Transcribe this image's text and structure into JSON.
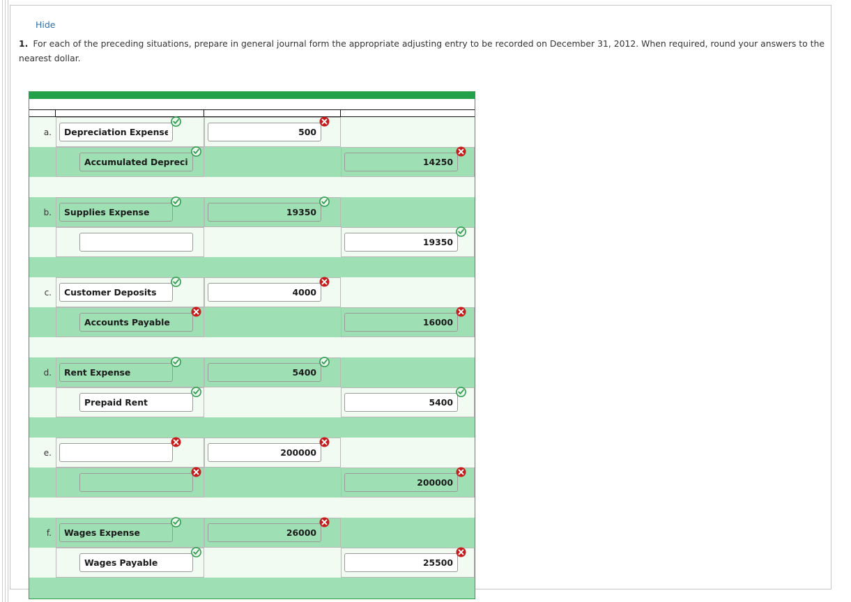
{
  "panel": {
    "hide_label": "Hide",
    "question_number": "1.",
    "question_text": "For each of the preceding situations, prepare in general journal form the appropriate adjusting entry to be recorded on December 31, 2012. When required, round your answers to the nearest dollar."
  },
  "colors": {
    "accent_green": "#22a14a",
    "row_green": "#9fdfb4",
    "row_light": "#f1fbf2",
    "correct": "#2f9e4f",
    "incorrect": "#c81c1c",
    "link": "#2f6fad"
  },
  "journal": {
    "entries": [
      {
        "label": "a.",
        "debit": {
          "account": "Depreciation Expense-Co",
          "account_status": "correct",
          "amount": "500",
          "amount_status": "incorrect"
        },
        "credit": {
          "account": "Accumulated Depreciatio",
          "account_status": "correct",
          "amount": "14250",
          "amount_status": "incorrect"
        }
      },
      {
        "label": "b.",
        "debit": {
          "account": "Supplies Expense",
          "account_status": "correct",
          "amount": "19350",
          "amount_status": "correct"
        },
        "credit": {
          "account": "",
          "account_status": "none",
          "amount": "19350",
          "amount_status": "correct"
        }
      },
      {
        "label": "c.",
        "debit": {
          "account": "Customer Deposits",
          "account_status": "correct",
          "amount": "4000",
          "amount_status": "incorrect"
        },
        "credit": {
          "account": "Accounts Payable",
          "account_status": "incorrect",
          "amount": "16000",
          "amount_status": "incorrect"
        }
      },
      {
        "label": "d.",
        "debit": {
          "account": "Rent Expense",
          "account_status": "correct",
          "amount": "5400",
          "amount_status": "correct"
        },
        "credit": {
          "account": "Prepaid Rent",
          "account_status": "correct",
          "amount": "5400",
          "amount_status": "correct"
        }
      },
      {
        "label": "e.",
        "debit": {
          "account": "",
          "account_status": "incorrect",
          "amount": "200000",
          "amount_status": "incorrect"
        },
        "credit": {
          "account": "",
          "account_status": "incorrect",
          "amount": "200000",
          "amount_status": "incorrect"
        }
      },
      {
        "label": "f.",
        "debit": {
          "account": "Wages Expense",
          "account_status": "correct",
          "amount": "26000",
          "amount_status": "incorrect"
        },
        "credit": {
          "account": "Wages Payable",
          "account_status": "correct",
          "amount": "25500",
          "amount_status": "incorrect"
        }
      }
    ]
  }
}
